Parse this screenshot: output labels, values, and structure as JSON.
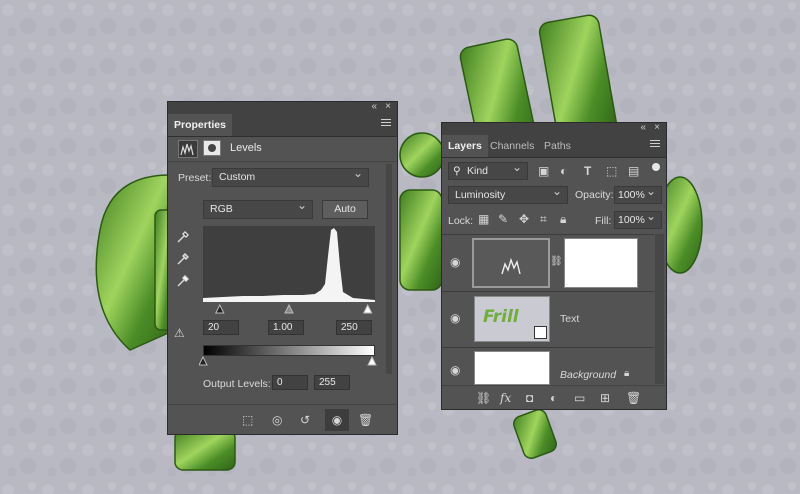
{
  "properties": {
    "title": "Properties",
    "header": "Levels",
    "preset_label": "Preset:",
    "preset_value": "Custom",
    "channel_value": "RGB",
    "auto_label": "Auto",
    "input_black": "20",
    "input_gamma": "1.00",
    "input_white": "250",
    "output_label": "Output Levels:",
    "output_black": "0",
    "output_white": "255"
  },
  "layers": {
    "tabs": [
      {
        "label": "Layers"
      },
      {
        "label": "Channels"
      },
      {
        "label": "Paths"
      }
    ],
    "filter_value": "Kind",
    "blend_mode": "Luminosity",
    "opacity_label": "Opacity:",
    "opacity_value": "100%",
    "lock_label": "Lock:",
    "fill_label": "Fill:",
    "fill_value": "100%",
    "rows": [
      {
        "name": ""
      },
      {
        "name": "Text"
      },
      {
        "name": "Background"
      }
    ],
    "thumb_text": "Frill"
  },
  "colors": {
    "panel": "#535353",
    "panel_dark": "#424242",
    "canvas": "#b9bac4",
    "accent_green": "#6fae3a"
  },
  "histogram": {
    "input_black_frac": 0.078,
    "input_gamma_frac": 0.5,
    "input_white_frac": 0.98
  }
}
